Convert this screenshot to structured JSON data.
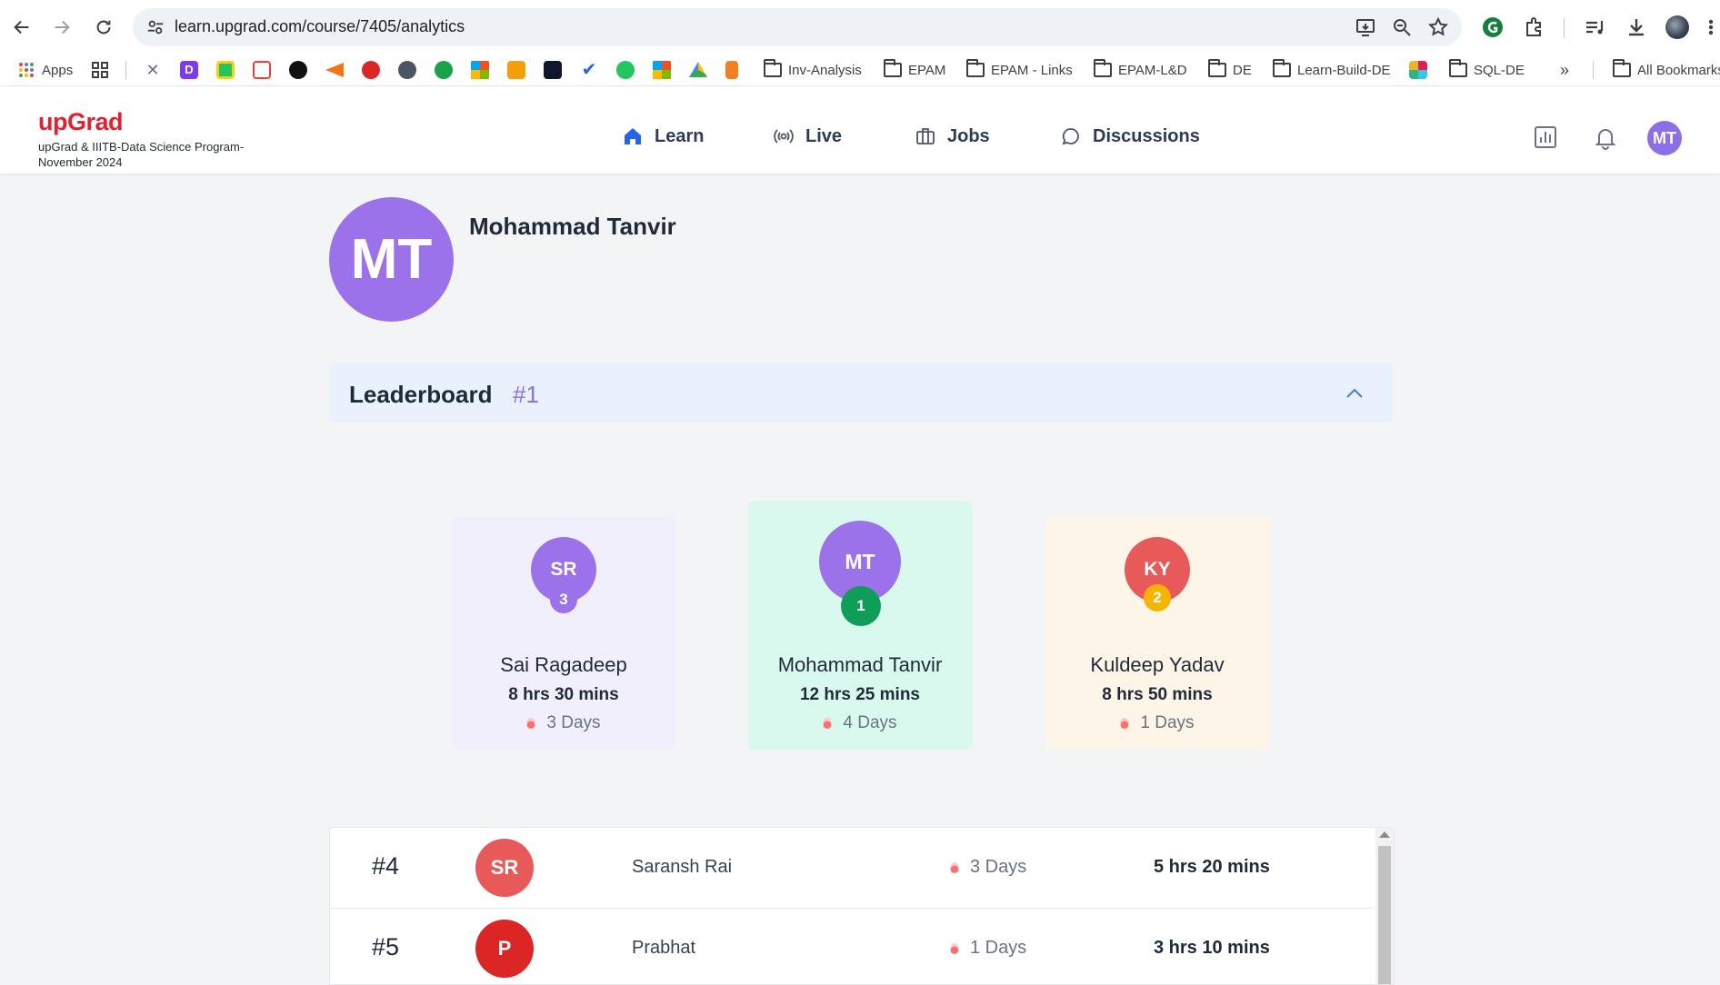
{
  "browser": {
    "url": "learn.upgrad.com/course/7405/analytics",
    "bookmarks": {
      "apps_label": "Apps",
      "folders": [
        "Inv-Analysis",
        "EPAM",
        "EPAM - Links",
        "EPAM-L&D",
        "DE",
        "Learn-Build-DE",
        "SQL-DE"
      ],
      "overflow": "»",
      "all_bookmarks": "All Bookmarks"
    }
  },
  "header": {
    "logo": "upGrad",
    "program": "upGrad & IIITB-Data Science Program-November 2024",
    "nav": [
      {
        "label": "Learn",
        "icon": "home-icon",
        "active": true
      },
      {
        "label": "Live",
        "icon": "broadcast-icon"
      },
      {
        "label": "Jobs",
        "icon": "briefcase-icon"
      },
      {
        "label": "Discussions",
        "icon": "chat-bubble-icon"
      }
    ],
    "avatar_initials": "MT"
  },
  "profile": {
    "initials": "MT",
    "name": "Mohammad Tanvir"
  },
  "leaderboard": {
    "title": "Leaderboard",
    "rank": "#1",
    "podium": [
      {
        "initials": "SR",
        "badge": "3",
        "name": "Sai Ragadeep",
        "time": "8 hrs 30 mins",
        "streak": "3 Days",
        "card_color": "#f2effc",
        "avatar_color": "#9b72ea",
        "badge_color": "#9b72ea"
      },
      {
        "initials": "MT",
        "badge": "1",
        "name": "Mohammad Tanvir",
        "time": "12 hrs 25 mins",
        "streak": "4 Days",
        "card_color": "#daf9ee",
        "avatar_color": "#9b72ea",
        "badge_color": "#0f9d58"
      },
      {
        "initials": "KY",
        "badge": "2",
        "name": "Kuldeep Yadav",
        "time": "8 hrs 50 mins",
        "streak": "1 Days",
        "card_color": "#fdf6e8",
        "avatar_color": "#e85a5a",
        "badge_color": "#f5b400"
      }
    ],
    "rows": [
      {
        "rank": "#4",
        "initials": "SR",
        "name": "Saransh Rai",
        "streak": "3 Days",
        "time": "5 hrs 20 mins",
        "avatar_color": "#e85a5a"
      },
      {
        "rank": "#5",
        "initials": "P",
        "name": "Prabhat",
        "streak": "1 Days",
        "time": "3 hrs 10 mins",
        "avatar_color": "#dc2626"
      }
    ]
  }
}
